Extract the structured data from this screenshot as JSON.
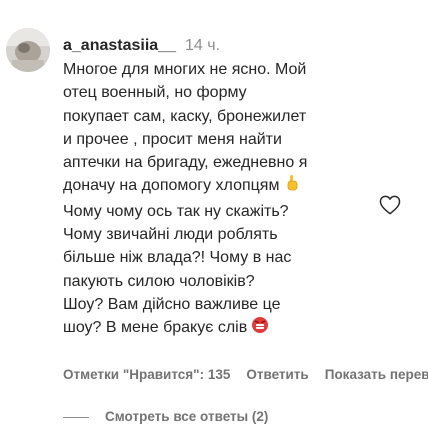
{
  "comment": {
    "username": "a_anastasiia__",
    "time": "14 ч.",
    "lines": [
      "Многое для многих не ясно. Мой",
      "отец военный, но форму",
      "покупает сам, каску, бронежилет",
      "и прочее , просит меня найти",
      "аптечки на бригаду, ежедневно я",
      "доначу на допомогу хлопцям",
      "Чому чому ось так ну скажіть?",
      "Чому звичайні люди роблять",
      "більше ніж влада?! Чому в нас",
      "пакують силою чоловіків?",
      "Шоу? Вам дійсно важливе це",
      "шоу? В мене бракує слів"
    ],
    "emojis": [
      "pointing-hand",
      "angry-face"
    ]
  },
  "actions": {
    "likes_label": "Отметки \"Нравится\": 135",
    "reply_label": "Ответить",
    "translate_label": "Показать перевод"
  },
  "replies": {
    "view_label": "Смотреть все ответы (2)"
  },
  "icons": {
    "like": "heart-outline-icon",
    "avatar": "user-avatar"
  }
}
